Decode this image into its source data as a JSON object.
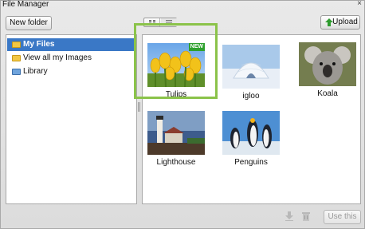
{
  "window": {
    "title": "File Manager",
    "close_glyph": "×"
  },
  "toolbar": {
    "new_folder_label": "New folder",
    "upload_label": "Upload",
    "view_modes": [
      "grid-view-icon",
      "list-view-icon"
    ]
  },
  "sidebar": {
    "items": [
      {
        "label": "My Files",
        "icon": "folder-open-icon",
        "selected": true
      },
      {
        "label": "View all my Images",
        "icon": "folder-icon",
        "selected": false
      },
      {
        "label": "Library",
        "icon": "library-folder-icon",
        "selected": false
      }
    ]
  },
  "files": [
    {
      "name": "Tulips",
      "badge": "NEW",
      "selected": true
    },
    {
      "name": "igloo"
    },
    {
      "name": "Koala"
    },
    {
      "name": "Lighthouse"
    },
    {
      "name": "Penguins"
    }
  ],
  "footer": {
    "use_this_label": "Use this"
  },
  "colors": {
    "selection": "#3a78c6",
    "highlight_frame": "#8bc34a",
    "badge_new": "#2ea12e"
  }
}
